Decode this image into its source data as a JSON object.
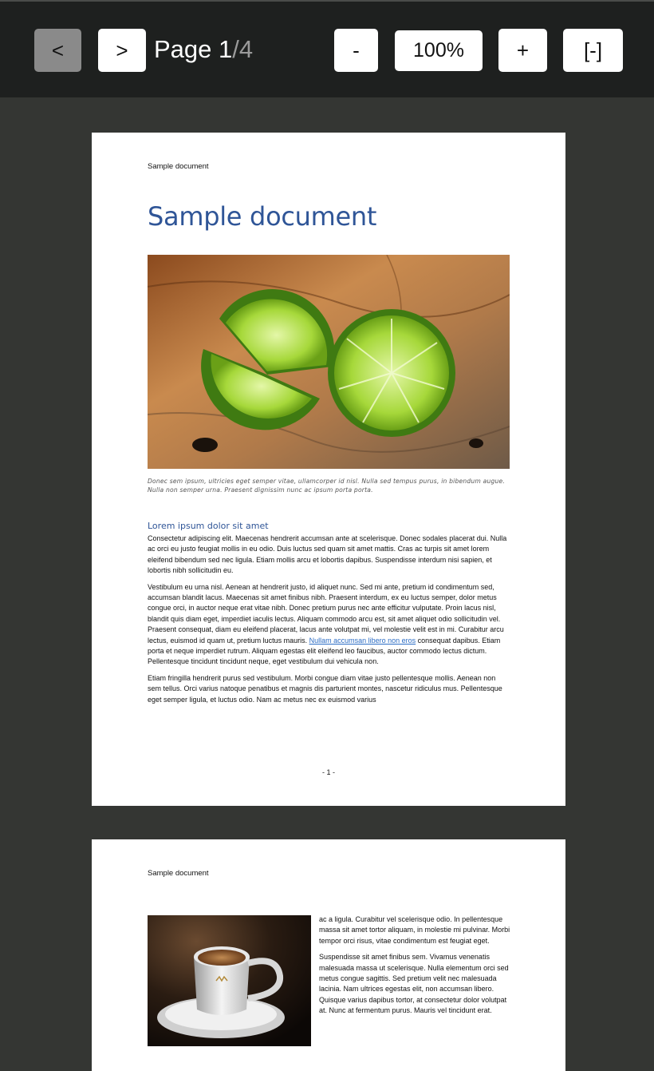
{
  "toolbar": {
    "prev_label": "<",
    "next_label": ">",
    "page_prefix": "Page ",
    "current_page": "1",
    "total_pages": "/4",
    "zoom_out_label": "-",
    "zoom_level": "100%",
    "zoom_in_label": "+",
    "fit_label": "[-]"
  },
  "page1": {
    "running_header": "Sample document",
    "title": "Sample document",
    "image_caption": "Donec sem ipsum, ultricies eget semper vitae, ullamcorper id nisl. Nulla sed tempus purus, in bibendum augue. Nulla non semper urna. Praesent dignissim nunc ac ipsum porta porta.",
    "heading": "Lorem ipsum dolor sit amet",
    "para1": "Consectetur adipiscing elit. Maecenas hendrerit accumsan ante at scelerisque. Donec sodales placerat dui. Nulla ac orci eu justo feugiat mollis in eu odio. Duis luctus sed quam sit amet mattis. Cras ac turpis sit amet lorem eleifend bibendum sed nec ligula. Etiam mollis arcu et lobortis dapibus. Suspendisse interdum nisi sapien, et lobortis nibh sollicitudin eu.",
    "para2_before_link": "Vestibulum eu urna nisl. Aenean at hendrerit justo, id aliquet nunc. Sed mi ante, pretium id condimentum sed, accumsan blandit lacus. Maecenas sit amet finibus nibh. Praesent interdum, ex eu luctus semper, dolor metus congue orci, in auctor neque erat vitae nibh. Donec pretium purus nec ante efficitur vulputate. Proin lacus nisl, blandit quis diam eget, imperdiet iaculis lectus. Aliquam commodo arcu est, sit amet aliquet odio sollicitudin vel. Praesent consequat, diam eu eleifend placerat, lacus ante volutpat mi, vel molestie velit est in mi. Curabitur arcu lectus, euismod id quam ut, pretium luctus mauris. ",
    "para2_link": "Nullam accumsan libero non eros",
    "para2_after_link": " consequat dapibus. Etiam porta et neque imperdiet rutrum. Aliquam egestas elit eleifend leo faucibus, auctor commodo lectus dictum. Pellentesque tincidunt tincidunt neque, eget vestibulum dui vehicula non.",
    "para3": "Etiam fringilla hendrerit purus sed vestibulum. Morbi congue diam vitae justo pellentesque mollis. Aenean non sem tellus. Orci varius natoque penatibus et magnis dis parturient montes, nascetur ridiculus mus. Pellentesque eget semper ligula, et luctus odio. Nam ac metus nec ex euismod varius",
    "page_number": "- 1 -"
  },
  "page2": {
    "running_header": "Sample document",
    "para1": "ac a ligula. Curabitur vel scelerisque odio. In pellentesque massa sit amet tortor aliquam, in molestie mi pulvinar. Morbi tempor orci risus, vitae condimentum est feugiat eget.",
    "para2": "Suspendisse sit amet finibus sem. Vivamus venenatis malesuada massa ut scelerisque. Nulla elementum orci sed metus congue sagittis. Sed pretium velit nec malesuada lacinia. Nam ultrices egestas elit, non accumsan libero. Quisque varius dapibus tortor, at consectetur dolor volutpat at. Nunc at fermentum purus. Mauris vel tincidunt erat."
  }
}
